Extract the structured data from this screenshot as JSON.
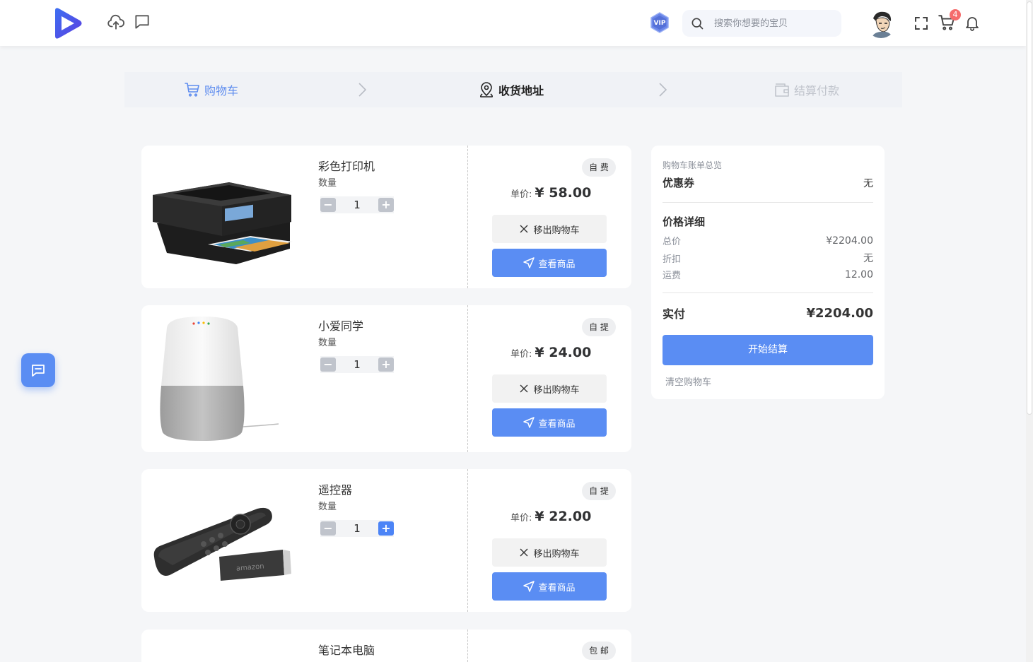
{
  "header": {
    "search_placeholder": "搜索你想要的宝贝",
    "vip_label": "VIP",
    "cart_count": "4"
  },
  "steps": [
    {
      "label": "购物车"
    },
    {
      "label": "收货地址"
    },
    {
      "label": "结算付款"
    }
  ],
  "cart": {
    "quantity_label": "数量",
    "price_label": "单价:",
    "remove_label": "移出购物车",
    "view_label": "查看商品",
    "items": [
      {
        "name": "彩色打印机",
        "quantity": "1",
        "tag": "自 费",
        "price": "¥ 58.00",
        "image": "printer"
      },
      {
        "name": "小爱同学",
        "quantity": "1",
        "tag": "自 提",
        "price": "¥ 24.00",
        "image": "smart-speaker"
      },
      {
        "name": "遥控器",
        "quantity": "1",
        "tag": "自 提",
        "price": "¥ 22.00",
        "image": "remote-control"
      },
      {
        "name": "笔记本电脑",
        "tag": "包 邮"
      }
    ]
  },
  "summary": {
    "caption": "购物车账单总览",
    "coupon_label": "优惠券",
    "coupon_value": "无",
    "detail_title": "价格详细",
    "total_label": "总价",
    "total_value": "¥2204.00",
    "discount_label": "折扣",
    "discount_value": "无",
    "shipping_label": "运费",
    "shipping_value": "12.00",
    "paid_label": "实付",
    "paid_value": "¥2204.00",
    "checkout_label": "开始结算",
    "clear_label": "清空购物车"
  },
  "colors": {
    "accent": "#5a8df3",
    "badge": "#f56c6c",
    "background": "#f5f6f8"
  }
}
